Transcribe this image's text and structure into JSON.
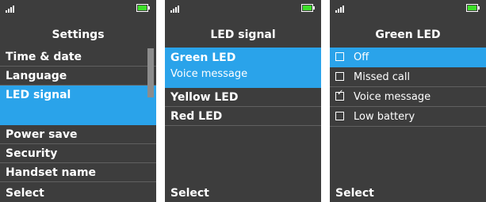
{
  "accent_color": "#2aa3ea",
  "battery_color": "#3ee02a",
  "screens": [
    {
      "title": "Settings",
      "items": [
        {
          "label": "Time & date",
          "selected": false
        },
        {
          "label": "Language",
          "selected": false
        },
        {
          "label": "LED signal",
          "selected": true
        },
        {
          "label": "Power save",
          "selected": false
        },
        {
          "label": "Security",
          "selected": false
        },
        {
          "label": "Handset name",
          "selected": false
        }
      ],
      "softkey": "Select"
    },
    {
      "title": "LED signal",
      "items": [
        {
          "label": "Green LED",
          "sublabel": "Voice message",
          "selected": true
        },
        {
          "label": "Yellow LED",
          "selected": false
        },
        {
          "label": "Red LED",
          "selected": false
        }
      ],
      "softkey": "Select"
    },
    {
      "title": "Green LED",
      "options": [
        {
          "label": "Off",
          "checked": false,
          "selected": true
        },
        {
          "label": "Missed call",
          "checked": false,
          "selected": false
        },
        {
          "label": "Voice message",
          "checked": true,
          "selected": false
        },
        {
          "label": "Low battery",
          "checked": false,
          "selected": false
        }
      ],
      "softkey": "Select"
    }
  ]
}
